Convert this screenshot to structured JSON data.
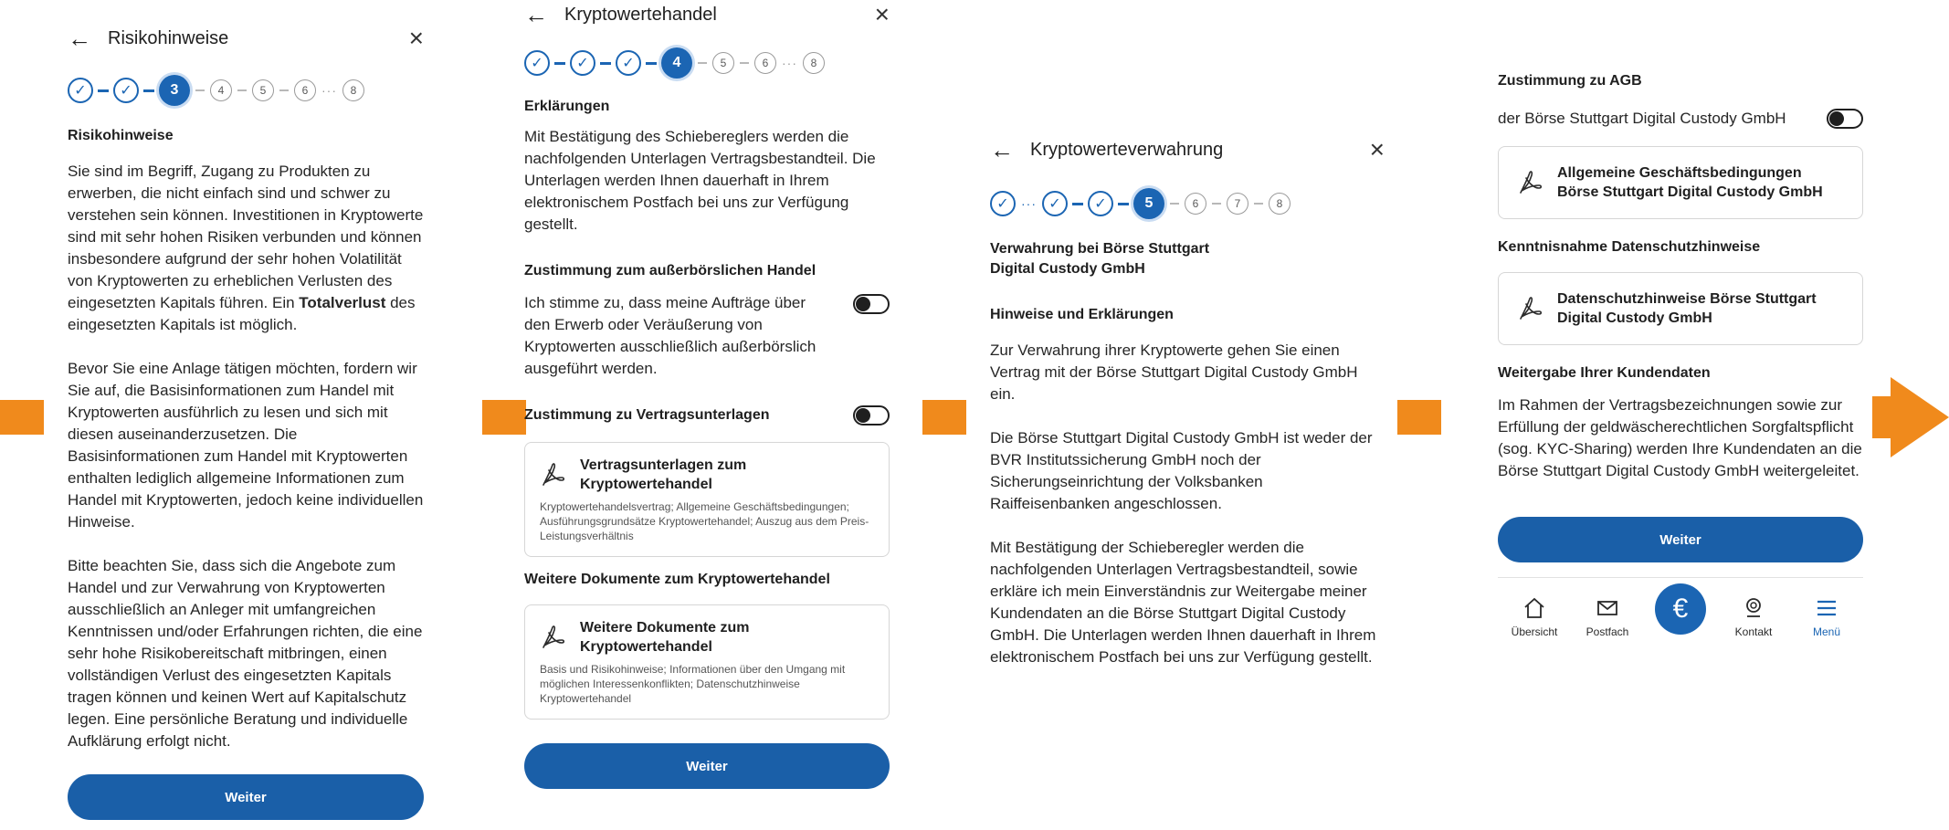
{
  "colors": {
    "primary": "#1a5fa8",
    "accent_arrow": "#f08a1c"
  },
  "screen1": {
    "title": "Risikohinweise",
    "steps": [
      "3",
      "4",
      "5",
      "6",
      "8"
    ],
    "heading": "Risikohinweise",
    "para1_a": "Sie sind im Begriff, Zugang zu Produkten zu erwerben, die nicht einfach sind und schwer zu verstehen sein können. Investitionen in Kryptowerte sind mit sehr hohen Risiken verbunden und können insbesondere aufgrund der sehr hohen Volatilität von Kryptowerten zu erheblichen Verlusten des eingesetzten Kapitals führen. Ein ",
    "para1_bold": "Totalverlust",
    "para1_b": " des eingesetzten Kapitals ist möglich.",
    "para2": "Bevor Sie eine Anlage tätigen möchten, fordern wir Sie auf, die Basisinformationen zum Handel mit Kryptowerten ausführlich zu lesen und sich mit diesen auseinanderzusetzen. Die Basisinformationen zum Handel mit Kryptowerten enthalten lediglich allgemeine Informationen zum Handel mit Kryptowerten, jedoch keine individuellen Hinweise.",
    "para3": "Bitte beachten Sie, dass sich die Angebote zum Handel und zur Verwahrung von Kryptowerten ausschließlich an Anleger mit umfangreichen Kenntnissen und/oder Erfahrungen richten, die eine sehr hohe Risikobereitschaft mitbringen, einen vollständigen Verlust des eingesetzten Kapitals tragen können und keinen Wert auf Kapitalschutz legen. Eine persönliche Beratung und individuelle Aufklärung erfolgt nicht.",
    "button": "Weiter"
  },
  "screen2": {
    "title": "Kryptowertehandel",
    "steps": [
      "4",
      "5",
      "6",
      "8"
    ],
    "heading": "Erklärungen",
    "intro": "Mit Bestätigung des Schiebereglers werden die nachfolgenden Unterlagen Vertragsbestandteil. Die Unterlagen werden Ihnen dauerhaft in Ihrem elektronischem Postfach bei uns zur Verfügung gestellt.",
    "section1_title": "Zustimmung zum außerbörslichen Handel",
    "section1_text": "Ich stimme zu, dass meine Aufträge über den Erwerb oder Veräußerung von Kryptowerten ausschließlich außerbörslich ausgeführt werden.",
    "section2_title": "Zustimmung zu Vertragsunterlagen",
    "card1_title": "Vertragsunterlagen zum Kryptowertehandel",
    "card1_sub": "Kryptowertehandelsvertrag; Allgemeine Geschäftsbedingungen; Ausführungsgrundsätze Kryptowertehandel; Auszug aus dem Preis-Leistungsverhältnis",
    "section3_title": "Weitere Dokumente zum Kryptowertehandel",
    "card2_title": "Weitere Dokumente zum Kryptowertehandel",
    "card2_sub": "Basis und Risikohinweise; Informationen über den Umgang mit möglichen Interessenkonflikten; Datenschutzhinweise Kryptowertehandel",
    "button": "Weiter"
  },
  "screen3": {
    "title": "Kryptowerteverwahrung",
    "steps": [
      "5",
      "6",
      "7",
      "8"
    ],
    "heading": "Verwahrung bei Börse Stuttgart Digital Custody GmbH",
    "subheading": "Hinweise und Erklärungen",
    "para1": "Zur Verwahrung ihrer Kryptowerte gehen Sie einen Vertrag mit der Börse Stuttgart Digital Custody GmbH ein.",
    "para2": "Die Börse Stuttgart Digital Custody GmbH ist weder der BVR Institutssicherung GmbH noch der Sicherungseinrichtung der Volksbanken Raiffeisenbanken angeschlossen.",
    "para3": "Mit Bestätigung der Schieberegler werden die nachfolgenden Unterlagen Vertragsbestandteil, sowie erkläre ich mein Einverständnis zur Weitergabe meiner Kundendaten an die Börse Stuttgart Digital Custody GmbH. Die Unterlagen werden Ihnen dauerhaft in Ihrem elektronischem Postfach bei uns zur Verfügung gestellt."
  },
  "screen4": {
    "section1_title": "Zustimmung zu AGB",
    "toggle_text": "der Börse Stuttgart Digital Custody GmbH",
    "card1_title": "Allgemeine Geschäftsbedingungen Börse Stuttgart Digital Custody GmbH",
    "section2_title": "Kenntnisnahme Datenschutzhinweise",
    "card2_title": "Datenschutzhinweise Börse Stuttgart Digital Custody GmbH",
    "section3_title": "Weitergabe Ihrer Kundendaten",
    "para": "Im Rahmen der Vertragsbezeichnungen sowie zur Erfüllung der geldwäscherechtlichen Sorgfaltspflicht (sog. KYC-Sharing) werden Ihre Kundendaten an die Börse Stuttgart Digital Custody GmbH weitergeleitet.",
    "button": "Weiter",
    "nav": {
      "overview": "Übersicht",
      "postbox": "Postfach",
      "center_symbol": "€",
      "contact": "Kontakt",
      "menu": "Menü"
    }
  }
}
